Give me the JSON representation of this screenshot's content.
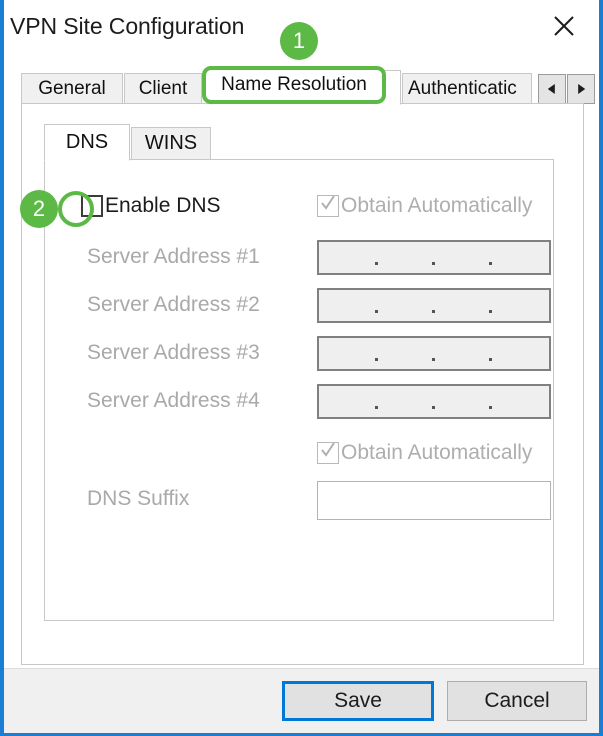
{
  "window": {
    "title": "VPN Site Configuration",
    "close_icon": "close-icon",
    "accent_border_color": "#1a7fd4"
  },
  "tabs": {
    "items": [
      {
        "label": "General",
        "active": false
      },
      {
        "label": "Client",
        "active": false
      },
      {
        "label": "Name Resolution",
        "active": true
      },
      {
        "label": "Authenticatic",
        "active": false
      }
    ],
    "scroll_left_icon": "triangle-left-icon",
    "scroll_right_icon": "triangle-right-icon"
  },
  "inner_tabs": {
    "items": [
      {
        "label": "DNS",
        "active": true
      },
      {
        "label": "WINS",
        "active": false
      }
    ]
  },
  "form": {
    "enable_dns": {
      "label": "Enable DNS",
      "checked": false,
      "disabled": false
    },
    "obtain_servers_automatically": {
      "label": "Obtain Automatically",
      "checked": true,
      "disabled": true
    },
    "obtain_suffix_automatically": {
      "label": "Obtain Automatically",
      "checked": true,
      "disabled": true
    },
    "server_addresses": [
      {
        "label": "Server Address #1",
        "value": ""
      },
      {
        "label": "Server Address #2",
        "value": ""
      },
      {
        "label": "Server Address #3",
        "value": ""
      },
      {
        "label": "Server Address #4",
        "value": ""
      }
    ],
    "dns_suffix": {
      "label": "DNS Suffix",
      "value": ""
    }
  },
  "footer": {
    "save_label": "Save",
    "cancel_label": "Cancel"
  },
  "annotations": {
    "color": "#5cb946",
    "badge_1": "1",
    "badge_2": "2",
    "highlighted_tab_label": "Name Resolution"
  }
}
